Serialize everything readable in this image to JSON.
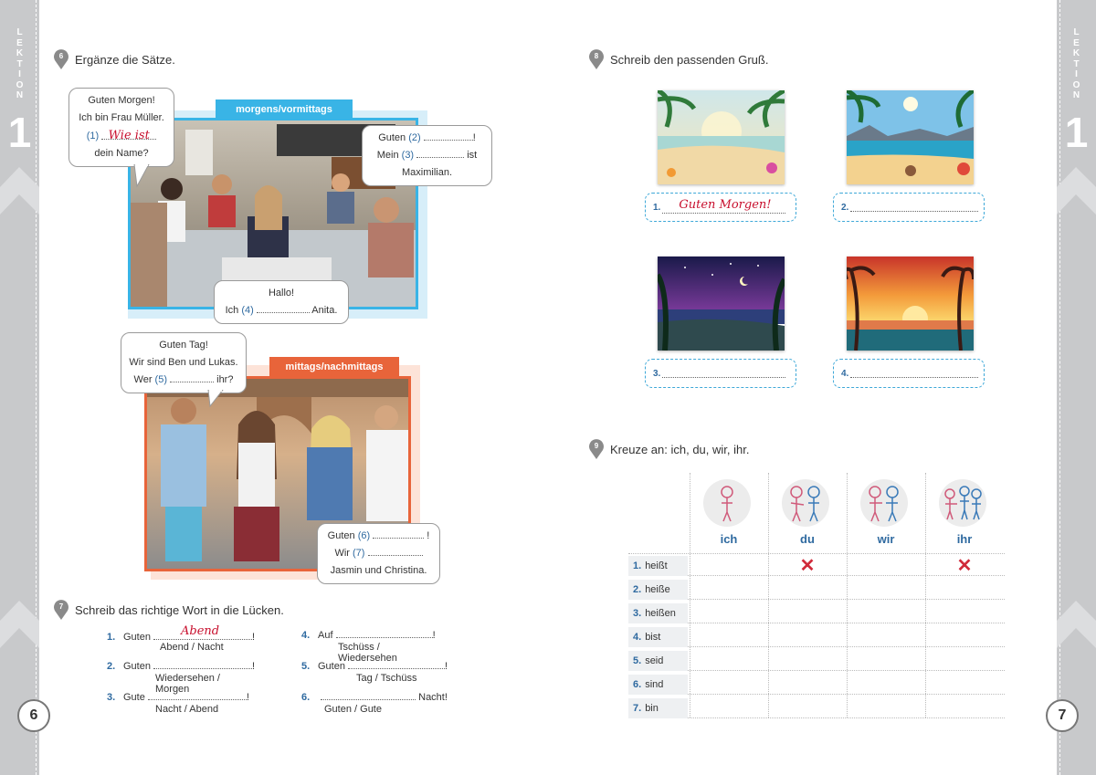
{
  "lektion": {
    "word": [
      "L",
      "E",
      "K",
      "T",
      "I",
      "O",
      "N"
    ],
    "number": "1"
  },
  "pages": {
    "left": "6",
    "right": "7"
  },
  "ex6": {
    "number": "6",
    "title": "Ergänze die Sätze.",
    "tag_morning": "morgens/vormittags",
    "tag_noon": "mittags/nachmittags",
    "bubble1": {
      "l1": "Guten Morgen!",
      "l2": "Ich bin Frau Müller.",
      "n": "(1)",
      "answer": "Wie ist",
      "l4": "dein Name?"
    },
    "bubble2": {
      "l1a": "Guten",
      "n2": "(2)",
      "l1b": "!",
      "l2a": "Mein",
      "n3": "(3)",
      "l2b": "ist",
      "l3": "Maximilian."
    },
    "bubble3": {
      "l1": "Hallo!",
      "l2a": "Ich",
      "n4": "(4)",
      "l2b": "Anita."
    },
    "bubble4": {
      "l1": "Guten Tag!",
      "l2": "Wir sind Ben und Lukas.",
      "l3a": "Wer",
      "n5": "(5)",
      "l3b": "ihr?"
    },
    "bubble5": {
      "l1a": "Guten",
      "n6": "(6)",
      "l1b": "!",
      "l2a": "Wir",
      "n7": "(7)",
      "l3": "Jasmin und Christina."
    }
  },
  "ex7": {
    "number": "7",
    "title": "Schreib das richtige Wort in die Lücken.",
    "items": [
      {
        "num": "1.",
        "pre": "Guten",
        "answer": "Abend",
        "post": "!",
        "hint": "Abend / Nacht"
      },
      {
        "num": "2.",
        "pre": "Guten",
        "answer": "",
        "post": "!",
        "hint": "Wiedersehen / Morgen"
      },
      {
        "num": "3.",
        "pre": "Gute",
        "answer": "",
        "post": "!",
        "hint": "Nacht / Abend"
      },
      {
        "num": "4.",
        "pre": "Auf",
        "answer": "",
        "post": "!",
        "hint": "Tschüss / Wiedersehen"
      },
      {
        "num": "5.",
        "pre": "Guten",
        "answer": "",
        "post": "!",
        "hint": "Tag / Tschüss"
      },
      {
        "num": "6.",
        "pre": "",
        "answer": "",
        "post": "Nacht!",
        "hint": "Guten / Gute"
      }
    ]
  },
  "ex8": {
    "number": "8",
    "title": "Schreib den passenden Gruß.",
    "boxes": [
      {
        "num": "1.",
        "answer": "Guten Morgen!"
      },
      {
        "num": "2.",
        "answer": ""
      },
      {
        "num": "3.",
        "answer": ""
      },
      {
        "num": "4.",
        "answer": ""
      }
    ]
  },
  "ex9": {
    "number": "9",
    "title": "Kreuze an: ich, du, wir, ihr.",
    "columns": [
      "ich",
      "du",
      "wir",
      "ihr"
    ],
    "rows": [
      {
        "num": "1.",
        "verb": "heißt",
        "marks": [
          false,
          true,
          false,
          true
        ]
      },
      {
        "num": "2.",
        "verb": "heiße",
        "marks": [
          false,
          false,
          false,
          false
        ]
      },
      {
        "num": "3.",
        "verb": "heißen",
        "marks": [
          false,
          false,
          false,
          false
        ]
      },
      {
        "num": "4.",
        "verb": "bist",
        "marks": [
          false,
          false,
          false,
          false
        ]
      },
      {
        "num": "5.",
        "verb": "seid",
        "marks": [
          false,
          false,
          false,
          false
        ]
      },
      {
        "num": "6.",
        "verb": "sind",
        "marks": [
          false,
          false,
          false,
          false
        ]
      },
      {
        "num": "7.",
        "verb": "bin",
        "marks": [
          false,
          false,
          false,
          false
        ]
      }
    ],
    "mark_symbol": "✕"
  },
  "colors": {
    "blue": "#2f6aa0",
    "cyan": "#39b4e6",
    "orange": "#e8643a",
    "red": "#c8102e",
    "grey": "#c8c9cb"
  }
}
